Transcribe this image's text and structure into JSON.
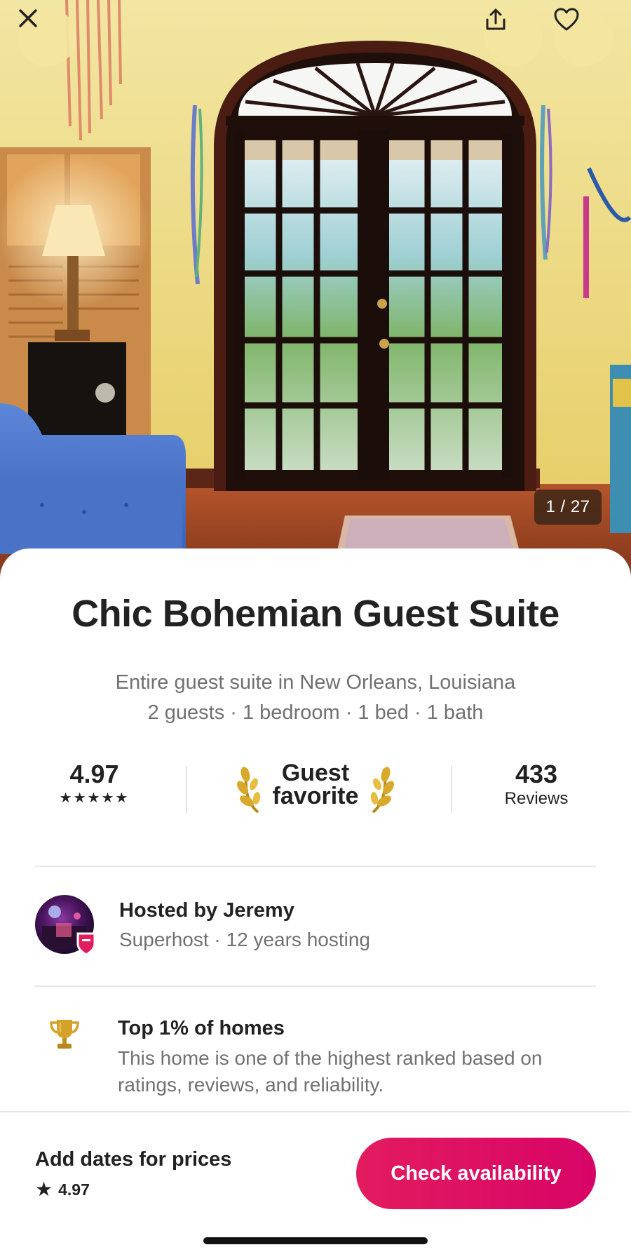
{
  "hero": {
    "photo_counter": "1 / 27",
    "close_icon": "close-icon",
    "share_icon": "share-icon",
    "heart_icon": "heart-icon"
  },
  "listing": {
    "title": "Chic Bohemian Guest Suite",
    "location": "Entire guest suite in New Orleans, Louisiana",
    "details": "2 guests · 1 bedroom · 1 bed · 1 bath"
  },
  "stats": {
    "rating": "4.97",
    "stars": "★★★★★",
    "badge_line1": "Guest",
    "badge_line2": "favorite",
    "reviews_count": "433",
    "reviews_label": "Reviews"
  },
  "host": {
    "name": "Hosted by Jeremy",
    "meta": "Superhost · 12 years hosting"
  },
  "highlight": {
    "title": "Top 1% of homes",
    "description": "This home is one of the highest ranked based on ratings, reviews, and reliability."
  },
  "footer": {
    "price_text": "Add dates for prices",
    "star_glyph": "★",
    "rating": "4.97",
    "cta_label": "Check availability"
  },
  "colors": {
    "brand": "#e31c5f",
    "text_primary": "#222222",
    "text_secondary": "#717171",
    "button_overlay": "#f4e5a0"
  }
}
